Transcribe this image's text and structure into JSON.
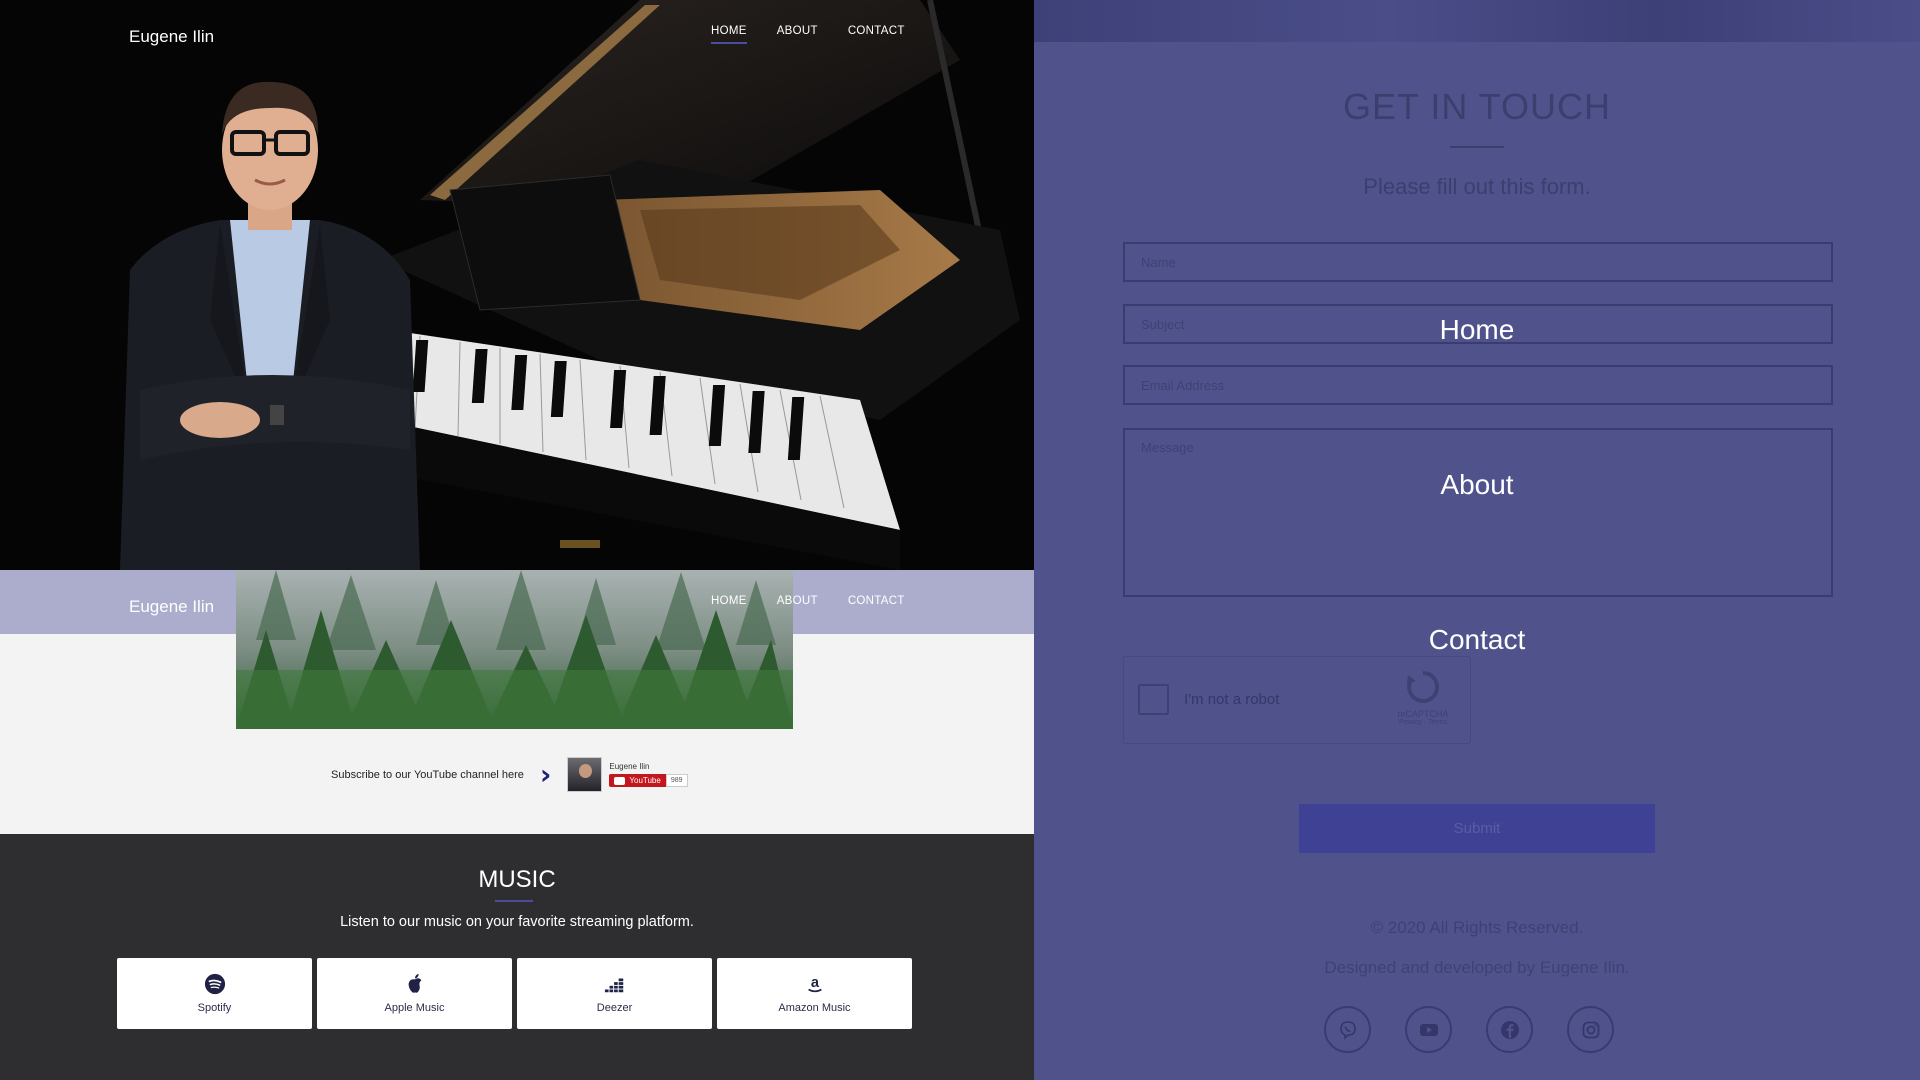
{
  "hero": {
    "brand": "Eugene Ilin",
    "nav": [
      "HOME",
      "ABOUT",
      "CONTACT"
    ]
  },
  "band": {
    "brand": "Eugene Ilin",
    "nav": [
      "HOME",
      "ABOUT",
      "CONTACT"
    ]
  },
  "youtube": {
    "subscribe_text": "Subscribe to our YouTube channel here",
    "channel_name": "Eugene Ilin",
    "button_label": "YouTube",
    "subscriber_count": "989"
  },
  "music": {
    "title": "MUSIC",
    "subtitle": "Listen to our music on your favorite streaming platform.",
    "platforms": [
      {
        "label": "Spotify",
        "icon": "spotify-icon"
      },
      {
        "label": "Apple Music",
        "icon": "apple-icon"
      },
      {
        "label": "Deezer",
        "icon": "deezer-icon"
      },
      {
        "label": "Amazon Music",
        "icon": "amazon-icon"
      }
    ]
  },
  "contact": {
    "title": "GET IN TOUCH",
    "subtitle": "Please fill out this form.",
    "placeholders": {
      "name": "Name",
      "subject": "Subject",
      "email": "Email Address",
      "message": "Message"
    },
    "captcha_label": "I'm not a robot",
    "captcha_brand": "reCAPTCHA",
    "captcha_links": "Privacy - Terms",
    "submit_label": "Submit"
  },
  "mobile_menu": [
    "Home",
    "About",
    "Contact"
  ],
  "footer": {
    "copyright": "© 2020 All Rights Reserved.",
    "credit": "Designed and developed by Eugene Ilin.",
    "socials": [
      "viber-icon",
      "youtube-icon",
      "facebook-icon",
      "instagram-icon"
    ]
  },
  "colors": {
    "accent": "#4b4d9c",
    "overlay": "#50538b",
    "dark_section": "#2e2e30"
  }
}
